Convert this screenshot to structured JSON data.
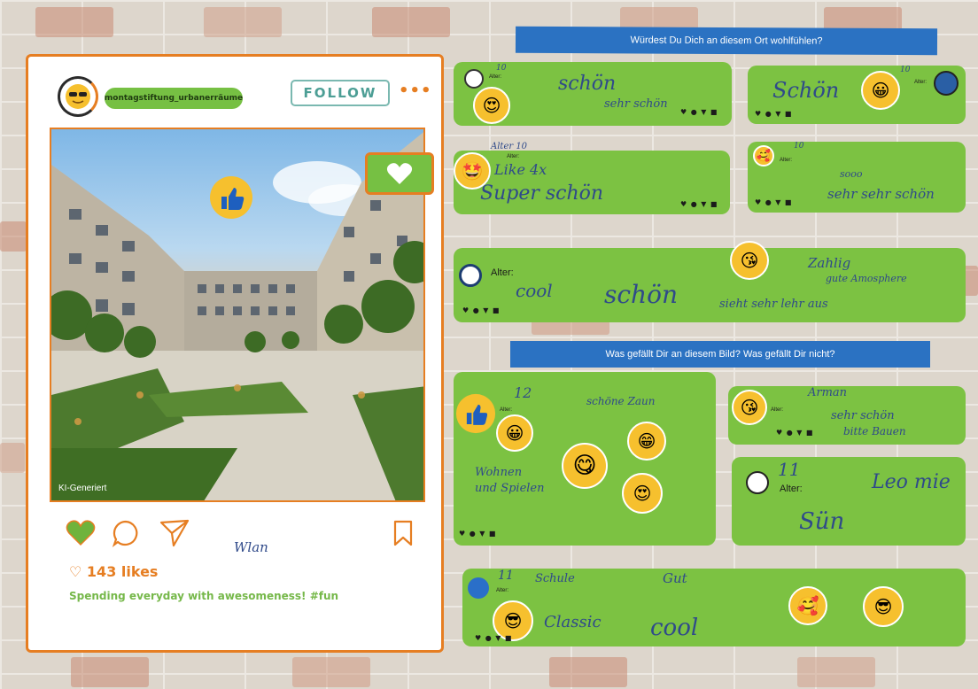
{
  "post": {
    "username": "montagstiftung_urbanerräume",
    "follow_label": "FOLLOW",
    "more_label": "•••",
    "photo_label": "KI-Generiert",
    "likes": "143 likes",
    "caption": "Spending everyday with awesomeness! #fun",
    "scribble": "Wlan"
  },
  "questions": {
    "q1": "Würdest Du Dich an diesem Ort wohlfühlen?",
    "q2": "Was gefällt Dir an diesem Bild? Was gefällt Dir nicht?"
  },
  "comments": {
    "c1": {
      "age": "10",
      "text1": "schön",
      "text2": "sehr schön"
    },
    "c2": {
      "age": "10",
      "text1": "Schön"
    },
    "c3": {
      "age": "Alter 10",
      "text1": "Like 4x",
      "text2": "Super schön"
    },
    "c4": {
      "age": "10",
      "text1": "sooo",
      "text2": "sehr sehr schön"
    },
    "c5": {
      "text1": "cool",
      "text2": "schön",
      "text3": "Zahlig",
      "text4": "gute Amosphere",
      "text5": "sieht sehr lehr aus"
    },
    "c6": {
      "age": "12",
      "text1": "Wohnen",
      "text2": "und Spielen",
      "text3": "schöne Zaun"
    },
    "c7": {
      "name": "Arman",
      "text1": "sehr schön",
      "text2": "bitte Bauen"
    },
    "c8": {
      "age": "11",
      "text1": "Leo mie",
      "text2": "Sün"
    },
    "c9": {
      "age": "11",
      "name": "Schule",
      "text1": "Gut",
      "text2": "Classic",
      "text3": "cool"
    }
  },
  "labels": {
    "alter": "Alter:",
    "icons": "♥ ● ▼ ■"
  },
  "colors": {
    "accent": "#e67e22",
    "green": "#7cc242",
    "tape": "#2b72c2",
    "follow": "#4c9e95"
  }
}
